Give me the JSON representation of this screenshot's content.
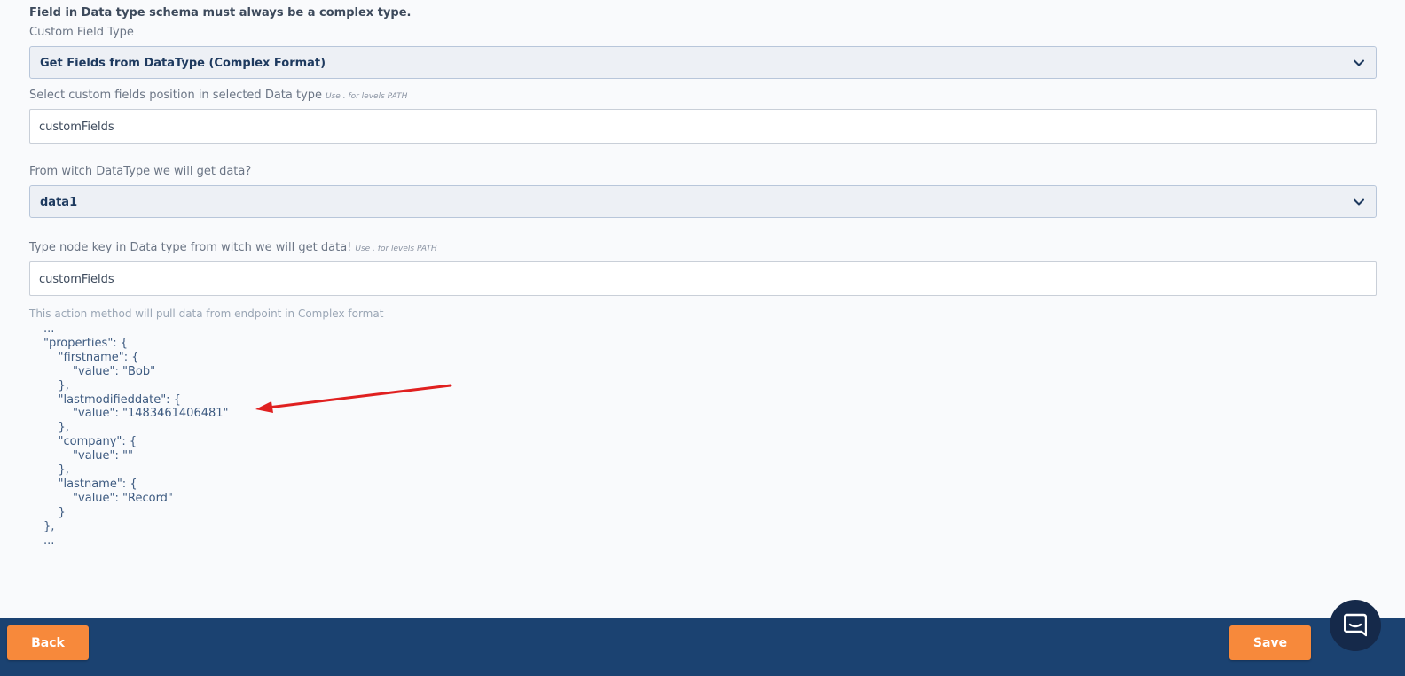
{
  "form": {
    "notice": "Field in Data type schema must always be a complex type.",
    "custom_field_type": {
      "label": "Custom Field Type",
      "value": "Get Fields from DataType (Complex Format)"
    },
    "position_field": {
      "label": "Select custom fields position in selected Data type",
      "hint": "Use . for levels PATH",
      "value": "customFields"
    },
    "source_datatype": {
      "label": "From witch DataType we will get data?",
      "value": "data1"
    },
    "node_key_field": {
      "label": "Type node key in Data type from witch we will get data!",
      "hint": "Use . for levels PATH",
      "value": "customFields"
    },
    "info_text": "This action method will pull data from endpoint in Complex format",
    "example_code": "...\n\"properties\": {\n    \"firstname\": {\n        \"value\": \"Bob\"\n    },\n    \"lastmodifieddate\": {\n        \"value\": \"1483461406481\"\n    },\n    \"company\": {\n        \"value\": \"\"\n    },\n    \"lastname\": {\n        \"value\": \"Record\"\n    }\n},\n..."
  },
  "footer": {
    "back_label": "Back",
    "save_label": "Save"
  },
  "colors": {
    "footer_bg": "#1b4271",
    "button_accent": "#f7893b",
    "arrow": "#e02020",
    "select_bg": "#edf0f5"
  },
  "icons": {
    "dropdown": "chevron-down-icon",
    "chat": "chat-icon",
    "annotation": "red-arrow-annotation"
  }
}
